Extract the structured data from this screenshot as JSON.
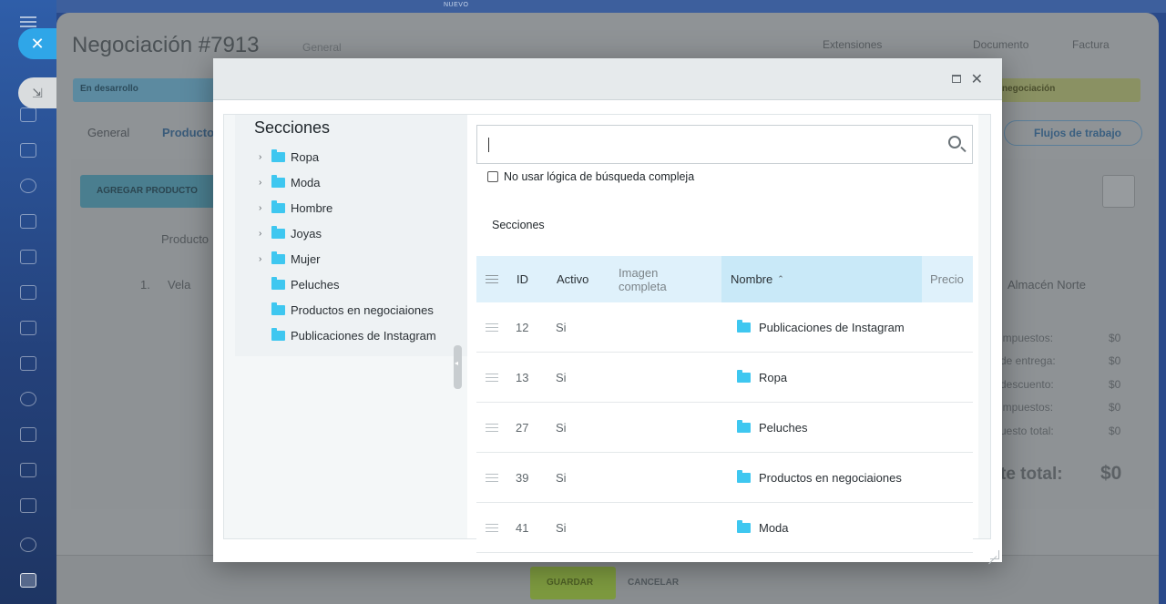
{
  "background": {
    "top_label": "NUEVO",
    "title": "Negociación #7913",
    "title_pipeline": "General",
    "extensions_label": "Extensiones",
    "document_label": "Documento",
    "invoice_label": "Factura",
    "stage_label": "En desarrollo",
    "stage_right_label": "negociación",
    "tabs": [
      "General",
      "Producto"
    ],
    "workflows_label": "Flujos de trabajo",
    "add_product_label": "AGREGAR PRODUCTO",
    "col_product": "Producto",
    "row_number": "1.",
    "row_product": "Vela",
    "warehouse": "Almacén Norte",
    "totals": [
      {
        "label": "impuestos:",
        "value": "$0"
      },
      {
        "label": "de entrega:",
        "value": "$0"
      },
      {
        "label": "descuento:",
        "value": "$0"
      },
      {
        "label": "impuestos:",
        "value": "$0"
      },
      {
        "label": "uesto total:",
        "value": "$0"
      }
    ],
    "grand_total_label": "te total:",
    "grand_total_value": "$0",
    "save_label": "GUARDAR",
    "cancel_label": "CANCELAR"
  },
  "modal": {
    "tree": {
      "title": "Secciones",
      "items": [
        {
          "label": "Ropa",
          "expandable": true
        },
        {
          "label": "Moda",
          "expandable": true
        },
        {
          "label": "Hombre",
          "expandable": true
        },
        {
          "label": "Joyas",
          "expandable": true
        },
        {
          "label": "Mujer",
          "expandable": true
        },
        {
          "label": "Peluches",
          "expandable": false
        },
        {
          "label": "Productos en negociaiones",
          "expandable": false
        },
        {
          "label": "Publicaciones de Instagram",
          "expandable": false
        }
      ]
    },
    "search": {
      "value": "",
      "checkbox_label": "No usar lógica de búsqueda compleja",
      "checkbox_checked": false
    },
    "section_label": "Secciones",
    "grid": {
      "headers": {
        "id": "ID",
        "active": "Activo",
        "image": "Imagen completa",
        "name": "Nombre",
        "price": "Precio"
      },
      "sort_indicator": "⌃",
      "rows": [
        {
          "id": "12",
          "active": "Si",
          "name": "Publicaciones de Instagram"
        },
        {
          "id": "13",
          "active": "Si",
          "name": "Ropa"
        },
        {
          "id": "27",
          "active": "Si",
          "name": "Peluches"
        },
        {
          "id": "39",
          "active": "Si",
          "name": "Productos en negociaiones"
        },
        {
          "id": "41",
          "active": "Si",
          "name": "Moda"
        }
      ]
    }
  },
  "colors": {
    "accent": "#2fa6e8",
    "folder": "#3ec7f0",
    "grid_header": "#dff1fb",
    "grid_header_sorted": "#c9e9f8"
  }
}
